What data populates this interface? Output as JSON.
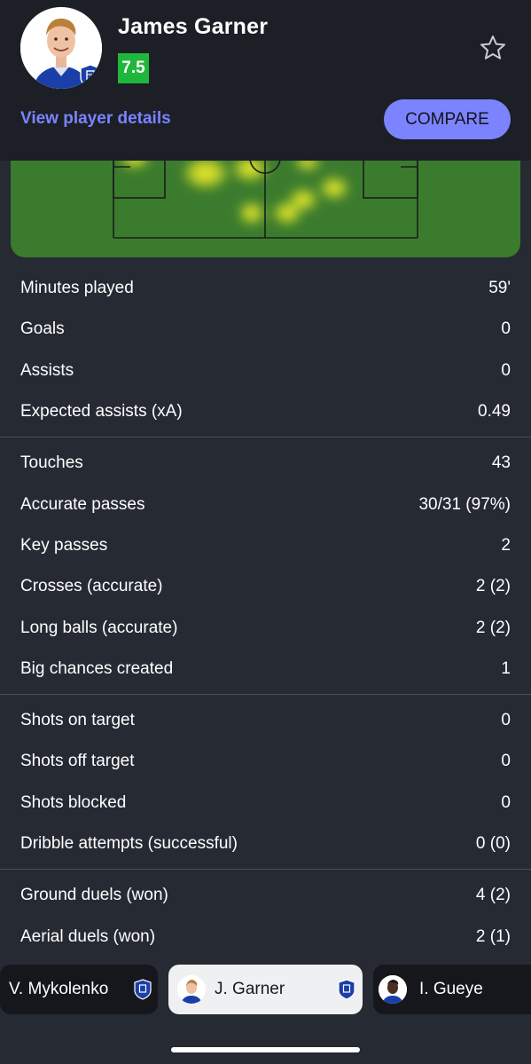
{
  "player": {
    "name": "James Garner",
    "rating": "7.5",
    "view_details": "View player details",
    "compare": "COMPARE"
  },
  "colors": {
    "rating_green": "#1fb73b",
    "accent": "#7c83ff",
    "pitch_green": "#3b7b2e"
  },
  "stats": {
    "groups": [
      {
        "rows": [
          {
            "label": "Minutes played",
            "value": "59'"
          },
          {
            "label": "Goals",
            "value": "0"
          },
          {
            "label": "Assists",
            "value": "0"
          },
          {
            "label": "Expected assists (xA)",
            "value": "0.49"
          }
        ]
      },
      {
        "rows": [
          {
            "label": "Touches",
            "value": "43"
          },
          {
            "label": "Accurate passes",
            "value": "30/31 (97%)"
          },
          {
            "label": "Key passes",
            "value": "2"
          },
          {
            "label": "Crosses (accurate)",
            "value": "2 (2)"
          },
          {
            "label": "Long balls (accurate)",
            "value": "2 (2)"
          },
          {
            "label": "Big chances created",
            "value": "1"
          }
        ]
      },
      {
        "rows": [
          {
            "label": "Shots on target",
            "value": "0"
          },
          {
            "label": "Shots off target",
            "value": "0"
          },
          {
            "label": "Shots blocked",
            "value": "0"
          },
          {
            "label": "Dribble attempts (successful)",
            "value": "0 (0)"
          }
        ]
      },
      {
        "rows": [
          {
            "label": "Ground duels (won)",
            "value": "4 (2)"
          },
          {
            "label": "Aerial duels (won)",
            "value": "2 (1)"
          }
        ]
      }
    ]
  },
  "bottom_nav": {
    "players": [
      {
        "label": "V. Mykolenko"
      },
      {
        "label": "J. Garner"
      },
      {
        "label": "I. Gueye"
      }
    ]
  },
  "icons": {
    "favorite": "star-outline-icon",
    "club": "everton-crest-icon"
  }
}
